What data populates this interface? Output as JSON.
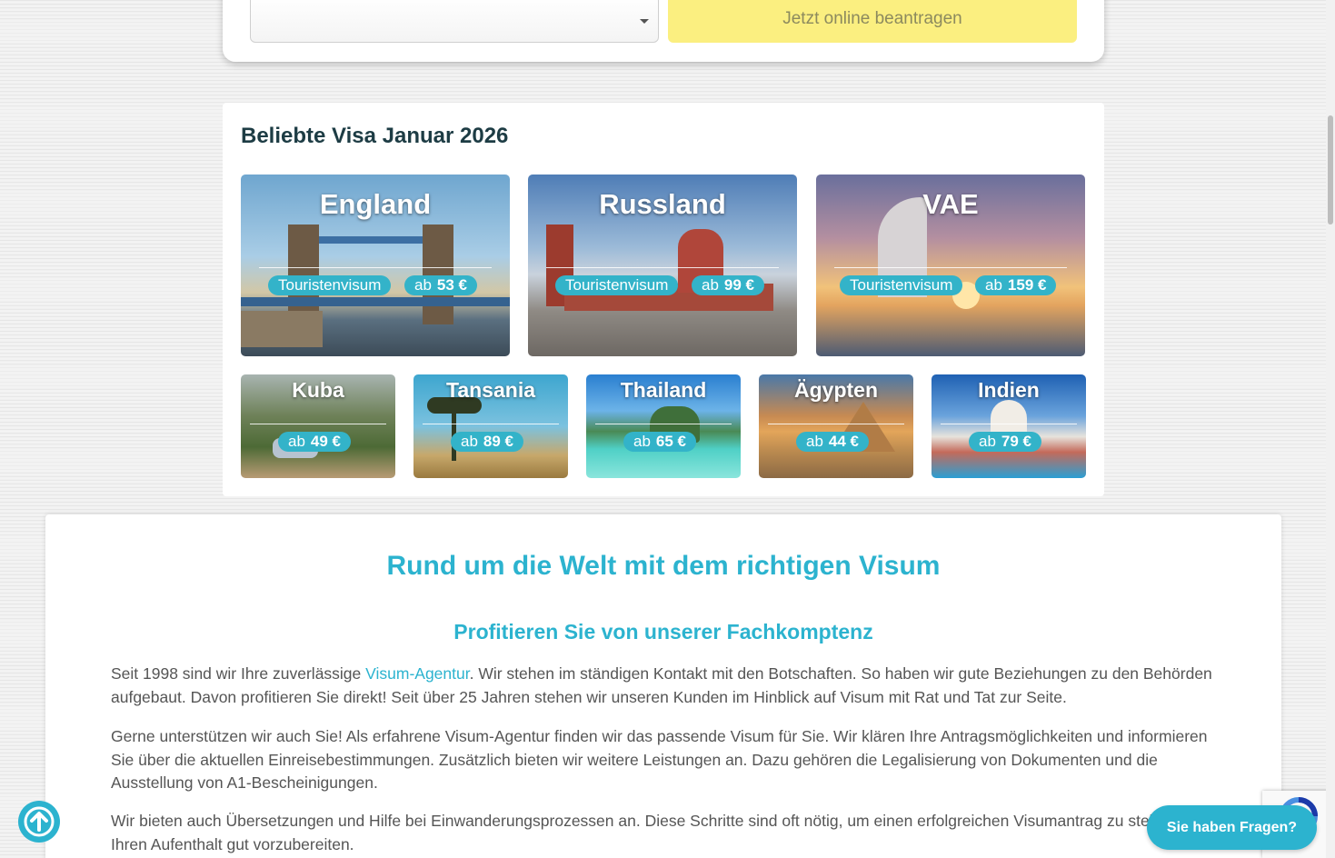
{
  "form": {
    "select_value": "",
    "apply_button": "Jetzt online beantragen"
  },
  "popular": {
    "title_bold": "Beliebte Visa",
    "title_rest": "Januar 2026",
    "big_tiles": [
      {
        "name": "England",
        "type": "Touristenvisum",
        "ab": "ab",
        "price": "53 €"
      },
      {
        "name": "Russland",
        "type": "Touristenvisum",
        "ab": "ab",
        "price": "99 €"
      },
      {
        "name": "VAE",
        "type": "Touristenvisum",
        "ab": "ab",
        "price": "159 €"
      }
    ],
    "small_tiles": [
      {
        "name": "Kuba",
        "ab": "ab",
        "price": "49 €"
      },
      {
        "name": "Tansania",
        "ab": "ab",
        "price": "89 €"
      },
      {
        "name": "Thailand",
        "ab": "ab",
        "price": "65 €"
      },
      {
        "name": "Ägypten",
        "ab": "ab",
        "price": "44 €"
      },
      {
        "name": "Indien",
        "ab": "ab",
        "price": "79 €"
      }
    ]
  },
  "info": {
    "title": "Rund um die Welt mit dem richtigen Visum",
    "subtitle": "Profitieren Sie von unserer Fachkomptenz",
    "p1_before": "Seit 1998 sind wir Ihre zuverlässige ",
    "p1_link": "Visum-Agentur",
    "p1_after": ". Wir stehen im ständigen Kontakt mit den Botschaften. So haben wir gute Beziehungen zu den Behörden aufgebaut. Davon profitieren Sie direkt! Seit über 25 Jahren stehen wir unseren Kunden im Hinblick auf Visum mit Rat und Tat zur Seite.",
    "p2": "Gerne unterstützen wir auch Sie! Als erfahrene Visum-Agentur finden wir das passende Visum für Sie. Wir klären Ihre Antragsmöglichkeiten und informieren Sie über die aktuellen Einreisebestimmungen. Zusätzlich bieten wir weitere Leistungen an. Dazu gehören die Legalisierung von Dokumenten und die Ausstellung von A1-Bescheinigungen.",
    "p3": "Wir bieten auch Übersetzungen und Hilfe bei Einwanderungsprozessen an. Diese Schritte sind oft nötig, um einen erfolgreichen Visumantrag zu stellen oder Ihren Aufenthalt gut vorzubereiten."
  },
  "chat": {
    "label": "Sie haben Fragen?"
  },
  "icons": {
    "scroll_top": "arrow-up-icon",
    "recaptcha": "recaptcha-icon"
  },
  "colors": {
    "accent": "#2cb3cf",
    "apply": "#fbef80",
    "pill": "#33b3c9"
  }
}
